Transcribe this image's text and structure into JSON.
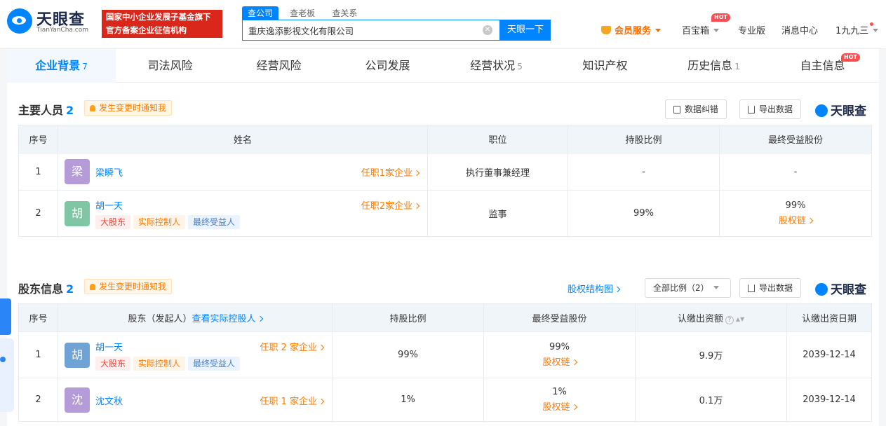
{
  "header": {
    "logo_text": "天眼查",
    "logo_sub": "TianYanCha.com",
    "gov_badge_line1": "国家中小企业发展子基金旗下",
    "gov_badge_line2": "官方备案企业征信机构",
    "search_tabs": [
      "查公司",
      "查老板",
      "查关系"
    ],
    "search_value": "重庆逸添影视文化有限公司",
    "search_button": "天眼一下",
    "vip_label": "会员服务",
    "treasure_label": "百宝箱",
    "pro_label": "专业版",
    "message_label": "消息中心",
    "user_label": "1九九三",
    "hot_label": "HOT"
  },
  "tabs": [
    {
      "label": "企业背景",
      "count": "7"
    },
    {
      "label": "司法风险",
      "count": ""
    },
    {
      "label": "经营风险",
      "count": ""
    },
    {
      "label": "公司发展",
      "count": ""
    },
    {
      "label": "经营状况",
      "count": "5"
    },
    {
      "label": "知识产权",
      "count": ""
    },
    {
      "label": "历史信息",
      "count": "1"
    },
    {
      "label": "自主信息",
      "count": ""
    }
  ],
  "staff": {
    "title": "主要人员",
    "count": "2",
    "notify": "发生变更时通知我",
    "btn_correct": "数据纠错",
    "btn_export": "导出数据",
    "logo": "天眼查",
    "columns": [
      "序号",
      "姓名",
      "职位",
      "持股比例",
      "最终受益股份"
    ],
    "rows": [
      {
        "no": "1",
        "avatar": "梁",
        "name": "梁瞬飞",
        "tenure": "任职1家企业",
        "position": "执行董事兼经理",
        "share": "-",
        "benefit": "-",
        "benefit_link": "",
        "tags": []
      },
      {
        "no": "2",
        "avatar": "胡",
        "name": "胡一天",
        "tenure": "任职2家企业",
        "position": "监事",
        "share": "99%",
        "benefit": "99%",
        "benefit_link": "股权链",
        "tags": [
          "大股东",
          "实际控制人",
          "最终受益人"
        ]
      }
    ]
  },
  "shareholders": {
    "title": "股东信息",
    "count": "2",
    "notify": "发生变更时通知我",
    "structure_link": "股权结构图",
    "filter": "全部比例（2）",
    "btn_export": "导出数据",
    "logo": "天眼查",
    "col_no": "序号",
    "col_holder": "股东（发起人）",
    "col_holder_link": "查看实际控股人",
    "col_share": "持股比例",
    "col_benefit": "最终受益股份",
    "col_amount": "认缴出资额",
    "col_date": "认缴出资日期",
    "rows": [
      {
        "no": "1",
        "avatar": "胡",
        "name": "胡一天",
        "tenure": "任职 2 家企业",
        "share": "99%",
        "benefit": "99%",
        "benefit_link": "股权链",
        "amount": "9.9万",
        "date": "2039-12-14",
        "tags": [
          "大股东",
          "实际控制人",
          "最终受益人"
        ]
      },
      {
        "no": "2",
        "avatar": "沈",
        "name": "沈文秋",
        "tenure": "任职 1 家企业",
        "share": "1%",
        "benefit": "1%",
        "benefit_link": "股权链",
        "amount": "0.1万",
        "date": "2039-12-14",
        "tags": []
      }
    ]
  },
  "colors": {
    "brand": "#0084ff",
    "accent_orange": "#ff7a00",
    "avatar_liang": "#b59cd9",
    "avatar_hu_1": "#7fc7a4",
    "avatar_hu_2": "#6fa3d6",
    "avatar_shen": "#b59cd9"
  }
}
